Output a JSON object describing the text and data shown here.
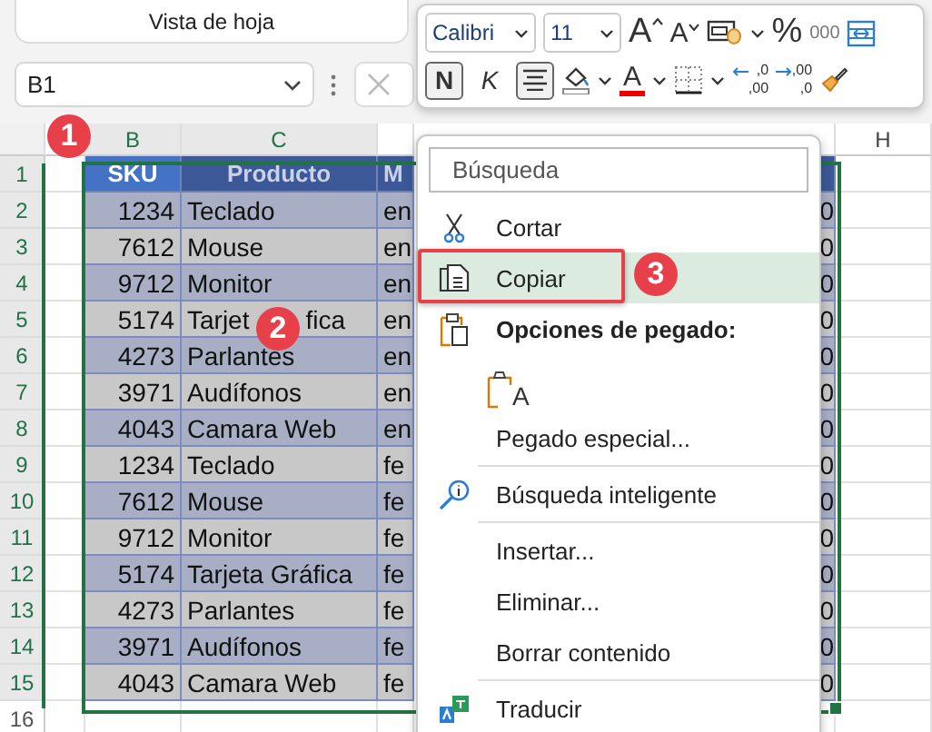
{
  "ribbon": {
    "group_label": "Vista de hoja"
  },
  "name_box": {
    "value": "B1"
  },
  "mini_toolbar": {
    "font": "Calibri",
    "size": "11",
    "grow_font": "A",
    "shrink_font": "A",
    "percent": "%",
    "thousands": "000",
    "bold": {
      "label": "N",
      "pressed": true
    },
    "italic": {
      "label": "K",
      "pressed": false
    },
    "align_center": {
      "pressed": true
    },
    "font_color": {
      "label": "A"
    },
    "decrease_decimal": [
      ",0",
      ",00"
    ],
    "increase_decimal": [
      ",00",
      ",0"
    ]
  },
  "sheet": {
    "column_b": "B",
    "column_c": "C",
    "column_h": "H",
    "row_headers": [
      "1",
      "2",
      "3",
      "4",
      "5",
      "6",
      "7",
      "8",
      "9",
      "10",
      "11",
      "12",
      "13",
      "14",
      "15",
      "16"
    ],
    "table": {
      "header": {
        "sku": "SKU",
        "product": "Producto",
        "column_d": "M"
      },
      "rows": [
        {
          "sku": "1234",
          "product": "Teclado",
          "column_d": "en",
          "column_g": "0"
        },
        {
          "sku": "7612",
          "product": "Mouse",
          "column_d": "en",
          "column_g": "0"
        },
        {
          "sku": "9712",
          "product": "Monitor",
          "column_d": "en",
          "column_g": "0"
        },
        {
          "sku": "5174",
          "product": "Tarjet",
          "product_after_callout": "fica",
          "column_d": "en",
          "column_g": "0"
        },
        {
          "sku": "4273",
          "product": "Parlantes",
          "column_d": "en",
          "column_g": "0"
        },
        {
          "sku": "3971",
          "product": "Audífonos",
          "column_d": "en",
          "column_g": "0"
        },
        {
          "sku": "4043",
          "product": "Camara Web",
          "column_d": "en",
          "column_g": "0"
        },
        {
          "sku": "1234",
          "product": "Teclado",
          "column_d": "fe",
          "column_g": "0"
        },
        {
          "sku": "7612",
          "product": "Mouse",
          "column_d": "fe",
          "column_g": "0"
        },
        {
          "sku": "9712",
          "product": "Monitor",
          "column_d": "fe",
          "column_g": "0"
        },
        {
          "sku": "5174",
          "product": "Tarjeta Gráfica",
          "column_d": "fe",
          "column_g": "0"
        },
        {
          "sku": "4273",
          "product": "Parlantes",
          "column_d": "fe",
          "column_g": "0"
        },
        {
          "sku": "3971",
          "product": "Audífonos",
          "column_d": "fe",
          "column_g": "0"
        },
        {
          "sku": "4043",
          "product": "Camara Web",
          "column_d": "fe",
          "column_g": "0"
        }
      ]
    }
  },
  "context_menu": {
    "search_placeholder": "Búsqueda",
    "items": [
      {
        "kind": "cut",
        "label": "Cortar",
        "selected": false
      },
      {
        "kind": "copy",
        "label": "Copiar",
        "selected": true
      },
      {
        "kind": "heading",
        "label": "Opciones de pegado:"
      },
      {
        "kind": "paste-option",
        "label": "A",
        "selected": false
      },
      {
        "kind": "plain",
        "label": "Pegado especial...",
        "selected": false
      },
      {
        "kind": "separator"
      },
      {
        "kind": "lookup",
        "label": "Búsqueda inteligente",
        "selected": false
      },
      {
        "kind": "separator"
      },
      {
        "kind": "plain",
        "label": "Insertar...",
        "selected": false
      },
      {
        "kind": "plain",
        "label": "Eliminar...",
        "selected": false
      },
      {
        "kind": "plain",
        "label": "Borrar contenido",
        "selected": false
      },
      {
        "kind": "separator"
      },
      {
        "kind": "translate",
        "label": "Traducir",
        "selected": false
      }
    ]
  },
  "callouts": [
    "1",
    "2",
    "3"
  ]
}
